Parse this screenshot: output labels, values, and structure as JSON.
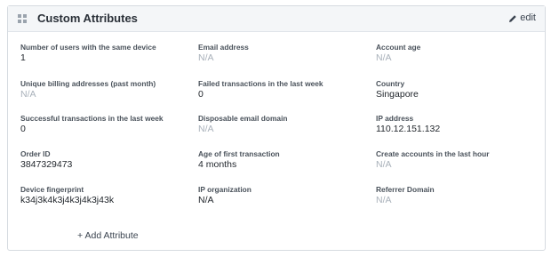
{
  "header": {
    "title": "Custom Attributes",
    "edit_label": "edit"
  },
  "attributes": [
    {
      "label": "Number of users with the same device",
      "value": "1",
      "empty": false
    },
    {
      "label": "Email address",
      "value": "N/A",
      "empty": true
    },
    {
      "label": "Account age",
      "value": "N/A",
      "empty": true
    },
    {
      "label": "Unique billing addresses (past month)",
      "value": "N/A",
      "empty": true
    },
    {
      "label": "Failed transactions in the last week",
      "value": "0",
      "empty": false
    },
    {
      "label": "Country",
      "value": "Singapore",
      "empty": false
    },
    {
      "label": "Successful transactions in the last week",
      "value": "0",
      "empty": false
    },
    {
      "label": "Disposable email domain",
      "value": "N/A",
      "empty": true
    },
    {
      "label": "IP address",
      "value": "110.12.151.132",
      "empty": false
    },
    {
      "label": "Order ID",
      "value": "3847329473",
      "empty": false
    },
    {
      "label": "Age of first transaction",
      "value": "4 months",
      "empty": false
    },
    {
      "label": "Create accounts in the last hour",
      "value": "N/A",
      "empty": true
    },
    {
      "label": "Device fingerprint",
      "value": "k34j3k4k3j4k3j4k3j43k",
      "empty": false
    },
    {
      "label": "IP organization",
      "value": "N/A",
      "empty": false
    },
    {
      "label": "Referrer Domain",
      "value": "N/A",
      "empty": true
    }
  ],
  "footer": {
    "add_label": "+ Add Attribute"
  },
  "colors": {
    "header_bg": "#f4f6f8",
    "border": "#d6dbe0",
    "label": "#4a525b",
    "value": "#1f242a",
    "value_empty": "#a9b1ba"
  },
  "icons": {
    "header": "grid-icon",
    "edit": "pencil-icon"
  }
}
